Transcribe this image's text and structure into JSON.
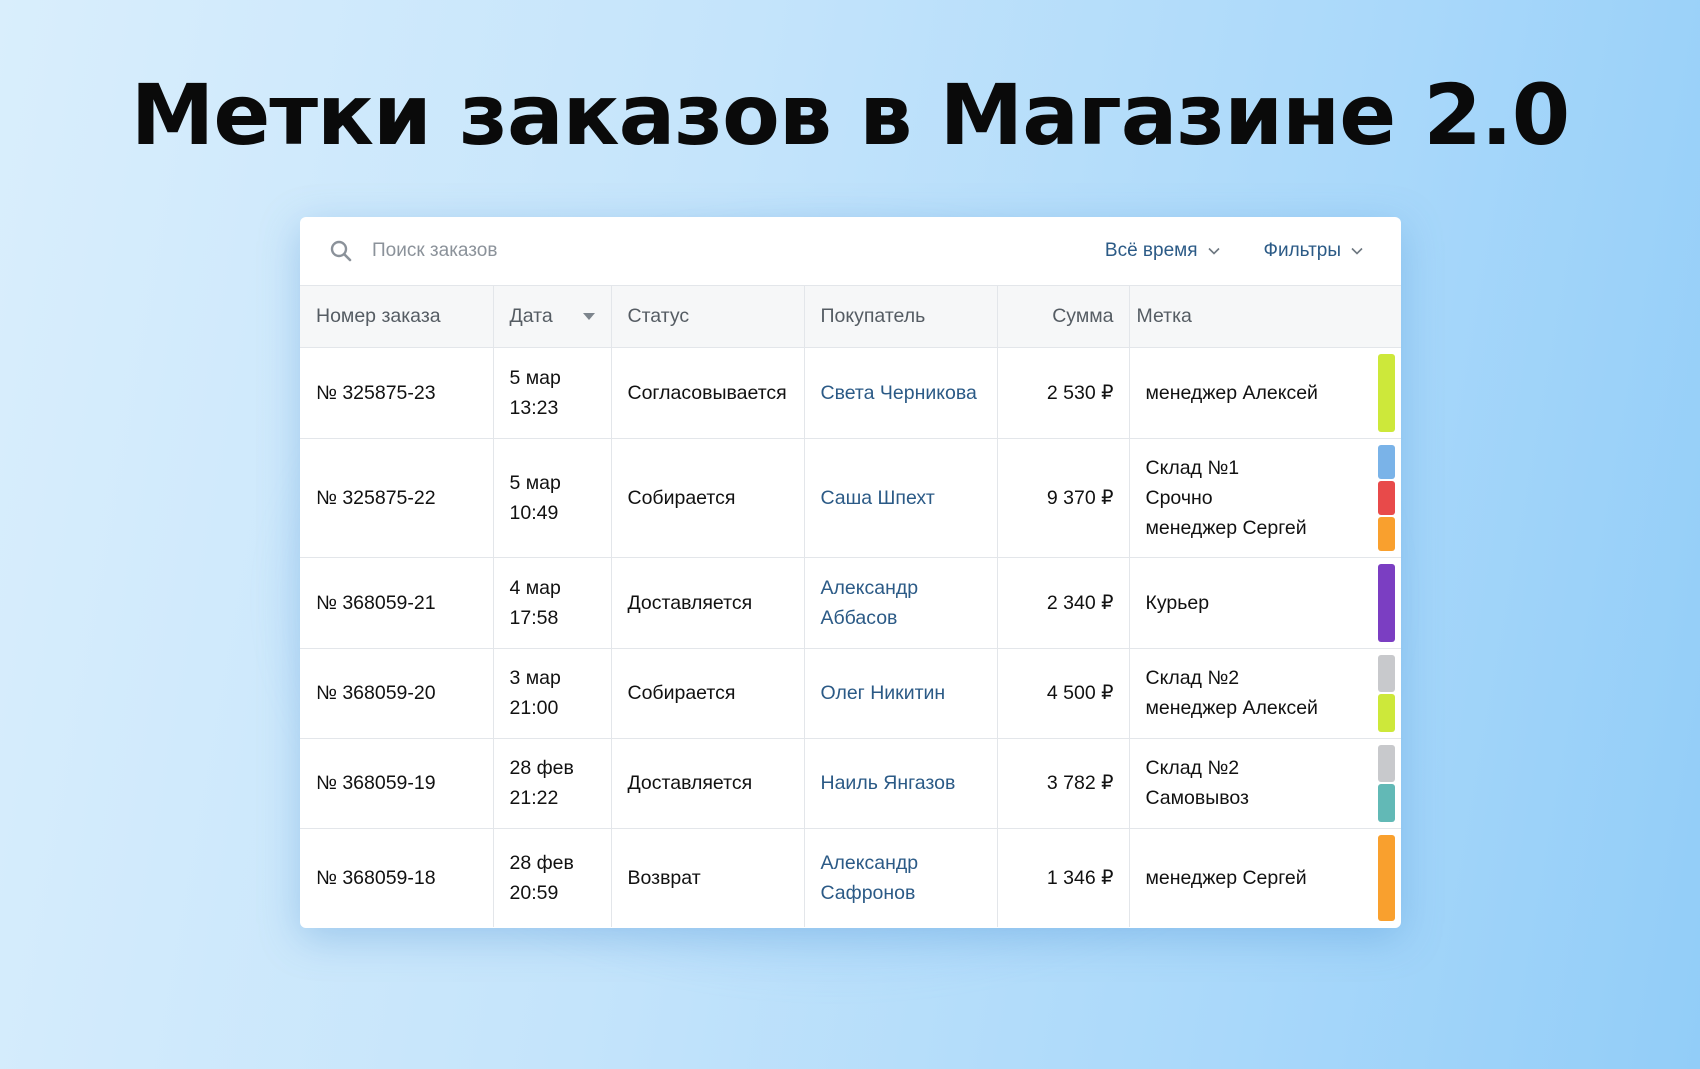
{
  "headline": "Метки заказов в Магазине 2.0",
  "toolbar": {
    "search_placeholder": "Поиск заказов",
    "period_label": "Всё время",
    "filters_label": "Фильтры"
  },
  "columns": {
    "order": "Номер заказа",
    "date": "Дата",
    "status": "Статус",
    "buyer": "Покупатель",
    "sum": "Сумма",
    "tag": "Метка"
  },
  "colors": {
    "lime": "#cde83a",
    "blue": "#7ab3e8",
    "red": "#e84a4a",
    "orange": "#f9a02e",
    "purple": "#7b3ec2",
    "gray": "#c8c9cc",
    "teal": "#62b9b6",
    "link": "#2b5a86"
  },
  "rows": [
    {
      "order": "№ 325875-23",
      "date_day": "5 мар",
      "date_time": "13:23",
      "status": "Согласовывается",
      "buyer_line1": "Света Черникова",
      "buyer_line2": "",
      "sum": "2 530 ₽",
      "tags": [
        "менеджер Алексей"
      ],
      "swatches": [
        "lime"
      ]
    },
    {
      "order": "№ 325875-22",
      "date_day": "5 мар",
      "date_time": "10:49",
      "status": "Собирается",
      "buyer_line1": "Саша Шпехт",
      "buyer_line2": "",
      "sum": "9 370 ₽",
      "tags": [
        "Склад №1",
        "Срочно",
        "менеджер Сергей"
      ],
      "swatches": [
        "blue",
        "red",
        "orange"
      ]
    },
    {
      "order": "№ 368059-21",
      "date_day": "4 мар",
      "date_time": "17:58",
      "status": "Доставляется",
      "buyer_line1": "Александр",
      "buyer_line2": "Аббасов",
      "sum": "2 340 ₽",
      "tags": [
        "Курьер"
      ],
      "swatches": [
        "purple"
      ]
    },
    {
      "order": "№ 368059-20",
      "date_day": "3 мар",
      "date_time": "21:00",
      "status": "Собирается",
      "buyer_line1": "Олег Никитин",
      "buyer_line2": "",
      "sum": "4 500 ₽",
      "tags": [
        "Склад №2",
        "менеджер Алексей"
      ],
      "swatches": [
        "gray",
        "lime"
      ]
    },
    {
      "order": "№ 368059-19",
      "date_day": "28 фев",
      "date_time": "21:22",
      "status": "Доставляется",
      "buyer_line1": "Наиль Янгазов",
      "buyer_line2": "",
      "sum": "3 782 ₽",
      "tags": [
        "Склад №2",
        "Самовывоз"
      ],
      "swatches": [
        "gray",
        "teal"
      ]
    },
    {
      "order": "№ 368059-18",
      "date_day": "28 фев",
      "date_time": "20:59",
      "status": "Возврат",
      "buyer_line1": "Александр",
      "buyer_line2": "Сафронов",
      "sum": "1 346 ₽",
      "tags": [
        "менеджер Сергей"
      ],
      "swatches": [
        "orange"
      ]
    }
  ]
}
